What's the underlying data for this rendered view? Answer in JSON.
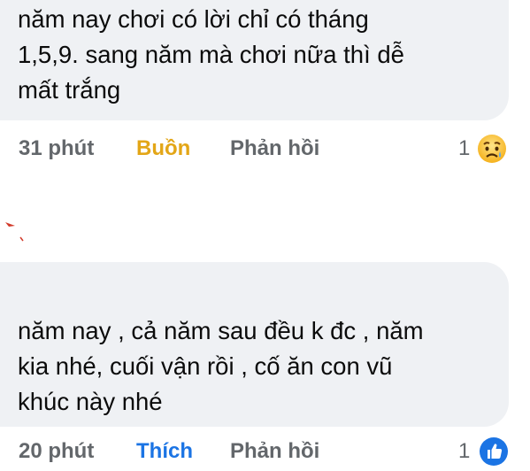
{
  "comments": [
    {
      "text": "năm nay chơi có lời chỉ có tháng\n1,5,9. sang năm mà chơi nữa thì dễ\nmất trắng",
      "time": "31 phút",
      "reaction_label": "Buồn",
      "reaction_color": "#e3a617",
      "reply_label": "Phản hồi",
      "reaction_count": "1",
      "reaction_icon": "sad-face-icon"
    },
    {
      "text": "năm nay , cả năm sau đều k đc , năm\nkia nhé, cuối vận rồi , cố ăn con vũ\nkhúc này nhé",
      "time": "20 phút",
      "reaction_label": "Thích",
      "reaction_color": "#1b74e4",
      "reply_label": "Phản hồi",
      "reaction_count": "1",
      "reaction_icon": "like-thumb-icon"
    }
  ],
  "colors": {
    "bubble_bg": "#eff1f4",
    "meta_text": "#63676b",
    "body_text": "#0b0b0b"
  }
}
